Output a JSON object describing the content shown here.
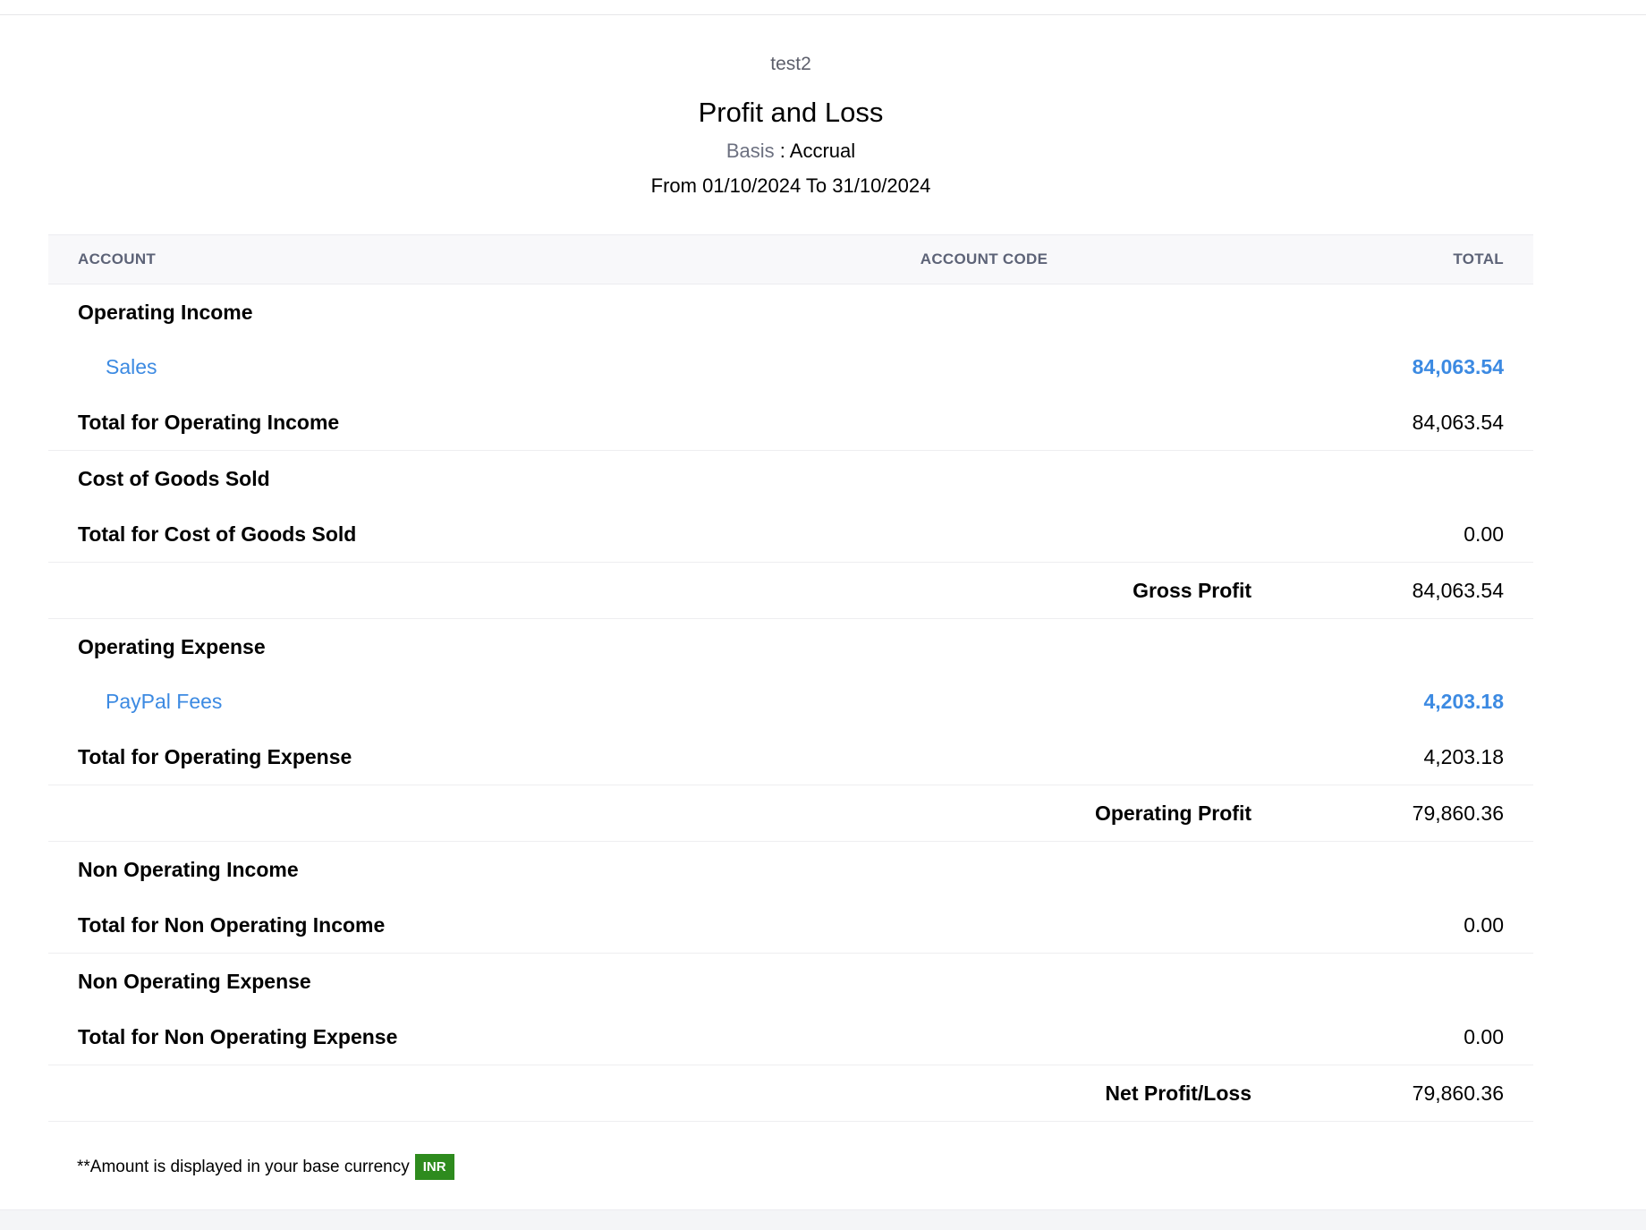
{
  "report": {
    "org_name": "test2",
    "title": "Profit and Loss",
    "basis_label": "Basis",
    "basis_sep": " : ",
    "basis_value": "Accrual",
    "range_text": "From 01/10/2024 To 31/10/2024"
  },
  "table": {
    "headers": {
      "account": "ACCOUNT",
      "code": "ACCOUNT CODE",
      "total": "TOTAL"
    },
    "operating_income": {
      "heading": "Operating Income",
      "accounts": [
        {
          "name": "Sales",
          "code": "",
          "total": "84,063.54"
        }
      ],
      "total_label": "Total for Operating Income",
      "total_value": "84,063.54"
    },
    "cogs": {
      "heading": "Cost of Goods Sold",
      "total_label": "Total for Cost of Goods Sold",
      "total_value": "0.00"
    },
    "gross_profit": {
      "label": "Gross Profit",
      "value": "84,063.54"
    },
    "operating_expense": {
      "heading": "Operating Expense",
      "accounts": [
        {
          "name": "PayPal Fees",
          "code": "",
          "total": "4,203.18"
        }
      ],
      "total_label": "Total for Operating Expense",
      "total_value": "4,203.18"
    },
    "operating_profit": {
      "label": "Operating Profit",
      "value": "79,860.36"
    },
    "non_operating_income": {
      "heading": "Non Operating Income",
      "total_label": "Total for Non Operating Income",
      "total_value": "0.00"
    },
    "non_operating_expense": {
      "heading": "Non Operating Expense",
      "total_label": "Total for Non Operating Expense",
      "total_value": "0.00"
    },
    "net_profit": {
      "label": "Net Profit/Loss",
      "value": "79,860.36"
    }
  },
  "footer": {
    "note": "**Amount is displayed in your base currency",
    "currency": "INR",
    "currency_color": "#2e8b1e"
  },
  "colors": {
    "link": "#3c8ae2",
    "header_bg": "#f8f8fa"
  }
}
